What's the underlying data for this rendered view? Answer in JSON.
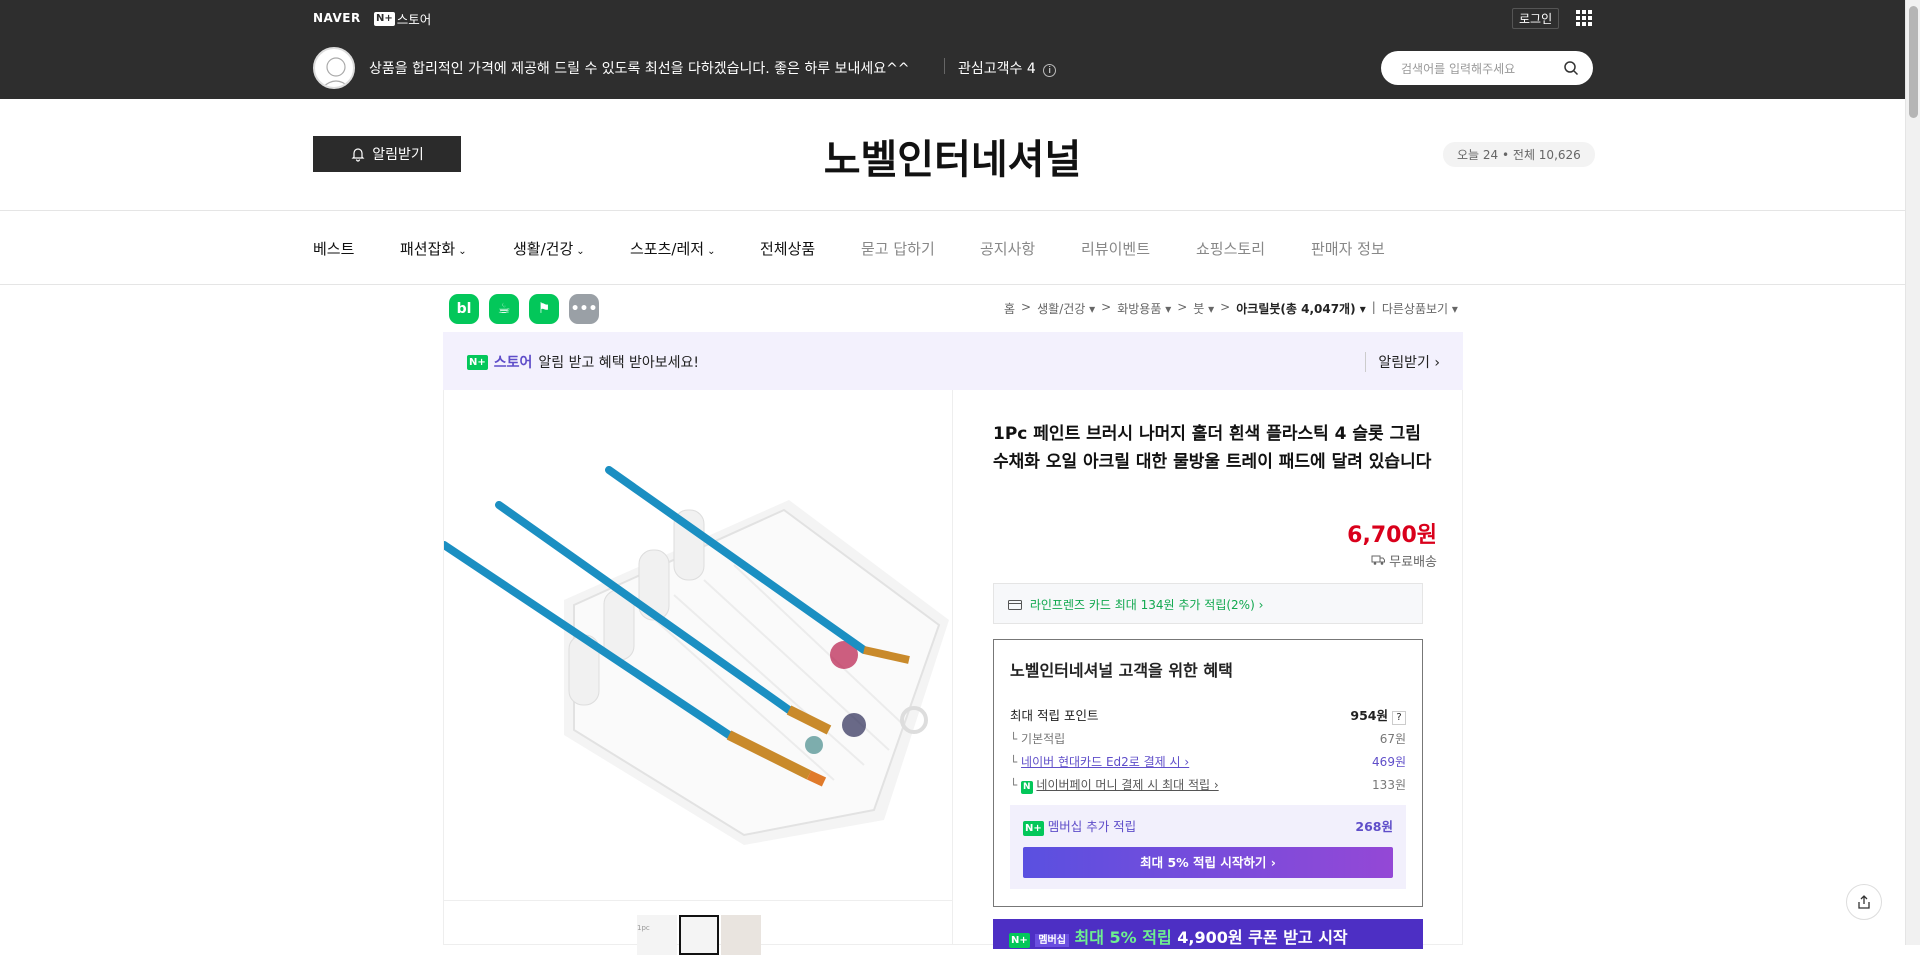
{
  "topbar": {
    "naver_logo": "NAVER",
    "nstore_badge": "N+",
    "nstore_label": "스토어",
    "login": "로그인",
    "greeting": "상품을 합리적인 가격에 제공해 드릴 수 있도록 최선을 다하겠습니다. 좋은 하루 보내세요^^",
    "favorite_label": "관심고객수 4",
    "favorite_info": "i",
    "search_placeholder": "검색어를 입력해주세요"
  },
  "header": {
    "alarm_button": "알림받기",
    "store_name": "노벨인터네셔널",
    "visits_today": "오늘 24",
    "visits_dot": "•",
    "visits_total": "전체 10,626"
  },
  "nav": {
    "items": [
      {
        "label": "베스트"
      },
      {
        "label": "패션잡화",
        "dropdown": "⌄"
      },
      {
        "label": "생활/건강",
        "dropdown": "⌄"
      },
      {
        "label": "스포츠/레저",
        "dropdown": "⌄"
      },
      {
        "label": "전체상품"
      },
      {
        "label": "묻고 답하기"
      },
      {
        "label": "공지사항"
      },
      {
        "label": "리뷰이벤트"
      },
      {
        "label": "쇼핑스토리"
      },
      {
        "label": "판매자 정보"
      }
    ]
  },
  "quick_icons": [
    {
      "label": "bl",
      "color": "#03c75a"
    },
    {
      "label": "☕",
      "color": "#03c75a"
    },
    {
      "label": "⚑",
      "color": "#03c75a"
    },
    {
      "label": "•••",
      "color": "#9aa0a6"
    }
  ],
  "breadcrumb": {
    "items": [
      "홈",
      ">",
      "생활/건강 ▾",
      ">",
      "화방용품 ▾",
      ">",
      "붓 ▾",
      ">",
      "아크릴붓(총 4,047개) ▾",
      "|",
      "다른상품보기 ▾"
    ]
  },
  "banner": {
    "badge": "N+",
    "store": "스토어",
    "text": "알림 받고 혜택 받아보세요!",
    "action": "알림받기 ›"
  },
  "product": {
    "title": "1Pc 페인트 브러시 나머지 홀더 흰색 플라스틱 4 슬롯 그림 수채화 오일 아크릴 대한 물방울 트레이 패드에 달려 있습니다",
    "price": "6,700원",
    "delivery": "무료배송",
    "card_benefit": "라인프렌즈 카드 최대 134원 추가 적립(2%) ›",
    "thumb_caption": "1pc"
  },
  "benefit": {
    "title": "노벨인터네셔널 고객을 위한 혜택",
    "max_points_label": "최대 적립 포인트",
    "max_points_value": "954원",
    "help": "?",
    "rows": [
      {
        "label": "기본적립",
        "value": "67원"
      },
      {
        "label": "네이버 현대카드 Ed2로 결제 시 ›",
        "value": "469원"
      },
      {
        "label": "네이버페이 머니 결제 시 최대 적립 ›",
        "value": "133원"
      }
    ],
    "npay_badge": "N",
    "member_badge": "N+",
    "member_label": "멤버십 추가 적립",
    "member_value": "268원",
    "member_button": "최대 5% 적립 시작하기 ›"
  },
  "promo": {
    "badge": "N+",
    "badge2": "멤버십",
    "accent": "최대 5% 적립",
    "text": "4,900원 쿠폰 받고 시작"
  }
}
